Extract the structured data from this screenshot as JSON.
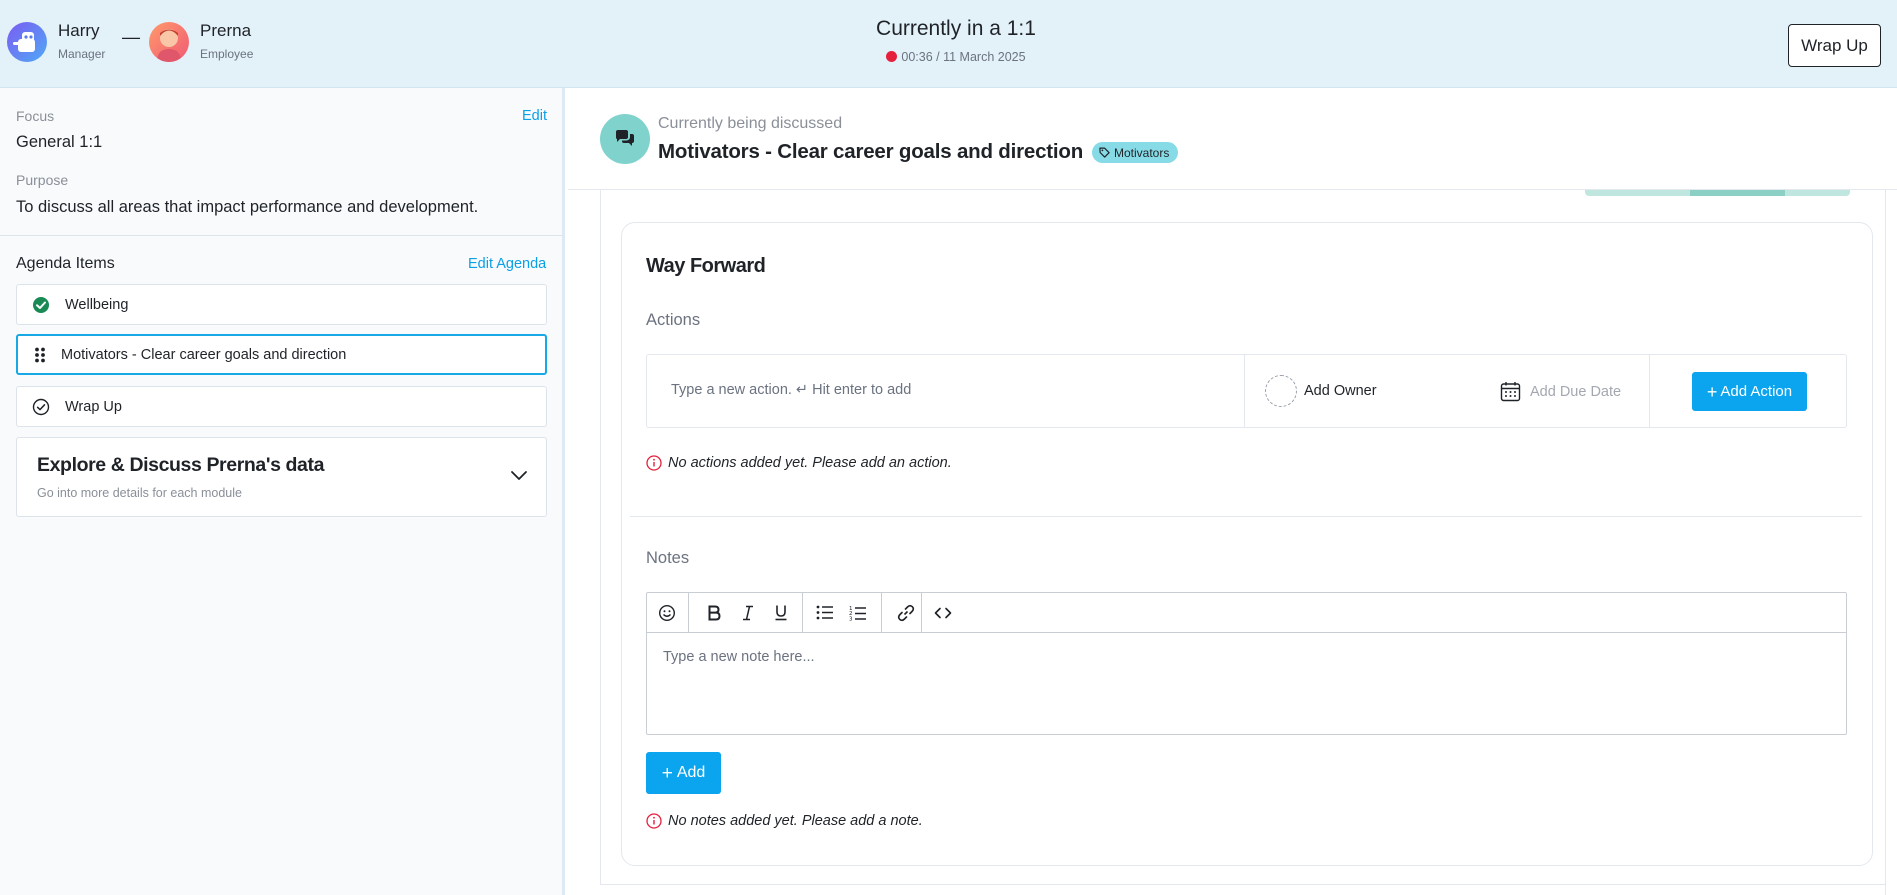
{
  "header": {
    "manager": {
      "name": "Harry",
      "role": "Manager"
    },
    "separator": "—",
    "employee": {
      "name": "Prerna",
      "role": "Employee"
    },
    "title": "Currently in a 1:1",
    "timer": "00:36 / 11 March 2025",
    "wrap_up_label": "Wrap Up",
    "rec_color": "#e5203c"
  },
  "sidebar": {
    "focus_label": "Focus",
    "focus_value": "General 1:1",
    "edit_label": "Edit",
    "purpose_label": "Purpose",
    "purpose_value": "To discuss all areas that impact performance and development.",
    "agenda_label": "Agenda Items",
    "edit_agenda_label": "Edit Agenda",
    "agenda_items": [
      {
        "label": "Wellbeing",
        "icon": "check-circle-filled-icon",
        "state": "done"
      },
      {
        "label": "Motivators - Clear career goals and direction",
        "icon": "drag-handle-icon",
        "state": "active"
      },
      {
        "label": "Wrap Up",
        "icon": "check-circle-outline-icon",
        "state": "pending"
      }
    ],
    "explore_title": "Explore & Discuss Prerna's data",
    "explore_subtitle": "Go into more details for each module"
  },
  "discussion": {
    "status_label": "Currently being discussed",
    "topic": "Motivators - Clear career goals and direction",
    "tag": "Motivators"
  },
  "way_forward": {
    "title": "Way Forward",
    "actions_label": "Actions",
    "action_placeholder": "Type a new action. ↵ Hit enter to add",
    "add_owner_label": "Add Owner",
    "add_due_date_label": "Add Due Date",
    "add_action_label": "Add Action",
    "no_actions_text": "No actions added yet. Please add an action.",
    "notes_label": "Notes",
    "note_placeholder": "Type a new note here...",
    "add_label": "Add",
    "no_notes_text": "No notes added yet. Please add a note."
  },
  "colors": {
    "accent": "#0aa5ee",
    "header_bg": "#e3f1f9",
    "success": "#1a8a55",
    "warning": "#e5203c",
    "tag_bg": "#86dbe6",
    "chat_bg": "#7fd3cc"
  }
}
